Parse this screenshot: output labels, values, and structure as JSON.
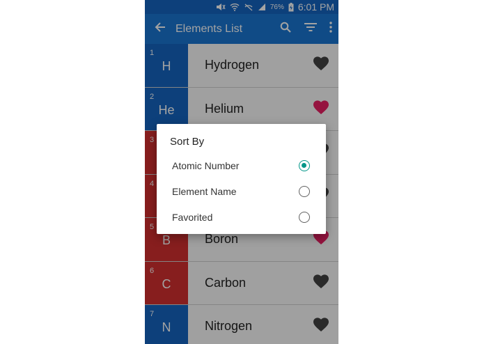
{
  "status_bar": {
    "battery": "76%",
    "time": "6:01 PM"
  },
  "app_bar": {
    "title": "Elements List",
    "icons": [
      "arrow-left-icon",
      "search-icon",
      "filter-icon",
      "more-vert-icon"
    ]
  },
  "colors": {
    "app_bar": "#1976d2",
    "status_bar": "#1565c0",
    "nonmetal": "#1565c0",
    "metal": "#d32f2f",
    "favorite": "#e91e63",
    "not_favorite": "#424242",
    "accent": "#009688"
  },
  "elements": [
    {
      "number": "1",
      "symbol": "H",
      "name": "Hydrogen",
      "color": "#1565c0",
      "favorite": false
    },
    {
      "number": "2",
      "symbol": "He",
      "name": "Helium",
      "color": "#1565c0",
      "favorite": true
    },
    {
      "number": "3",
      "symbol": "",
      "name": "",
      "color": "#d32f2f",
      "favorite": false
    },
    {
      "number": "4",
      "symbol": "",
      "name": "",
      "color": "#d32f2f",
      "favorite": false
    },
    {
      "number": "5",
      "symbol": "B",
      "name": "Boron",
      "color": "#d32f2f",
      "favorite": true
    },
    {
      "number": "6",
      "symbol": "C",
      "name": "Carbon",
      "color": "#d32f2f",
      "favorite": false
    },
    {
      "number": "7",
      "symbol": "N",
      "name": "Nitrogen",
      "color": "#1565c0",
      "favorite": false
    }
  ],
  "sort_dialog": {
    "title": "Sort By",
    "options": [
      {
        "label": "Atomic Number",
        "selected": true
      },
      {
        "label": "Element Name",
        "selected": false
      },
      {
        "label": "Favorited",
        "selected": false
      }
    ]
  }
}
